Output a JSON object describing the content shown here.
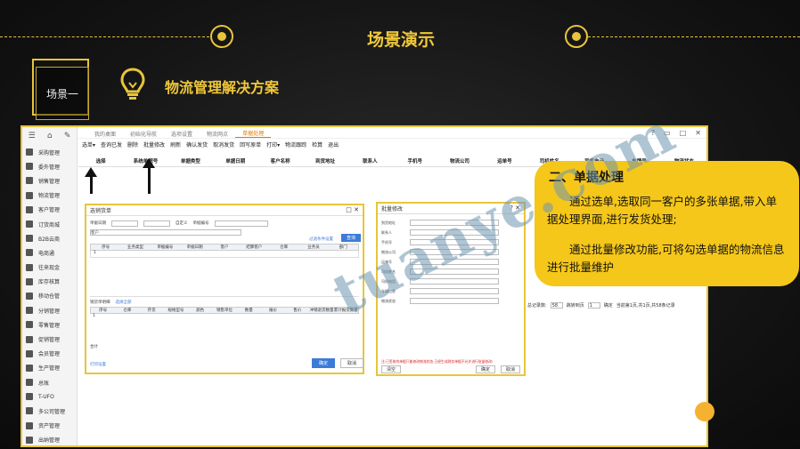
{
  "header": {
    "title": "场景演示"
  },
  "scene": {
    "label": "场景一",
    "title": "物流管理解决方案"
  },
  "app": {
    "tabs": [
      "我的桌面",
      "初始化导航",
      "选项设置",
      "物流网点",
      "单据处理"
    ],
    "toolbar": [
      "选单▾",
      "查询已发",
      "删除",
      "批量修改",
      "刷新",
      "确认发货",
      "取消发货",
      "回写原单",
      "打印▾",
      "物流跟踪",
      "检算",
      "退出"
    ],
    "columns": [
      "选择",
      "系统单据号",
      "单据类型",
      "单据日期",
      "客户名称",
      "到货地址",
      "联系人",
      "手机号",
      "物流公司",
      "运单号",
      "司机姓名",
      "司机电话",
      "车牌号",
      "物流状态"
    ],
    "sidebar": [
      "采购管理",
      "委外管理",
      "销售管理",
      "物流管理",
      "客户管理",
      "订货商城",
      "B2B云商",
      "电商通",
      "往来现金",
      "库存核算",
      "移动仓管",
      "分销管理",
      "零售管理",
      "促销管理",
      "会员管理",
      "生产管理",
      "总账",
      "T-UFO",
      "多公司管理",
      "资产管理",
      "出纳管理"
    ]
  },
  "select_dialog": {
    "title": "选销货单",
    "date_label": "单据日期",
    "custom_label": "自定义",
    "doc_label": "单据编号",
    "customer_value": "客户",
    "saved_conditions": "过滤条件设置",
    "query_btn": "查询",
    "cols": [
      "序号",
      "业务类型",
      "单据编号",
      "单据日期",
      "客户",
      "结算客户",
      "仓库",
      "业务员",
      "部门"
    ],
    "row_no": "1",
    "detail_title": "销货单明细",
    "detail_hint": "选择全部",
    "detail_cols": [
      "序号",
      "仓库",
      "存货",
      "规格型号",
      "颜色",
      "销售单位",
      "数量",
      "报价",
      "售价",
      "冲销退货数量",
      "累计报货数量"
    ],
    "total_label": "合计",
    "print_label": "打印设置",
    "ok": "确定",
    "cancel": "取消"
  },
  "batch_dialog": {
    "title": "批量修改",
    "fields": [
      "到货地址",
      "联系人",
      "手机号",
      "物流公司",
      "运单号",
      "司机姓名",
      "司机电话",
      "车辆信息",
      "物流状态"
    ],
    "warning": "注:已签收的单据只能修改物流状态,已经生成财务单据不允许进行批量修改!",
    "clear": "清空",
    "ok": "确定",
    "cancel": "取消"
  },
  "pager": {
    "records_label": "总记录数:",
    "records": "58",
    "jump_label": "跳转到页",
    "page": "1",
    "confirm": "确定",
    "info": "当前第1页,共1页,共58条记录"
  },
  "callout": {
    "title": "二、单据处理",
    "p1": "通过选单,选取同一客户的多张单据,带入单据处理界面,进行发货处理;",
    "p2": "通过批量修改功能,可将勾选单据的物流信息进行批量维护"
  },
  "watermark": "tuanye.com",
  "colors": {
    "accent": "#e8c53a",
    "callout": "#f5c71a",
    "active_tab": "#e07a00",
    "button": "#3d7bd8"
  }
}
